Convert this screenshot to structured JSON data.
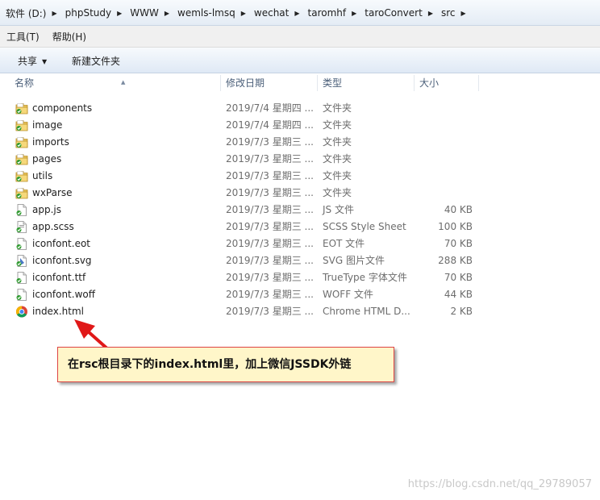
{
  "breadcrumb": [
    "软件 (D:)",
    "phpStudy",
    "WWW",
    "wemls-lmsq",
    "wechat",
    "taromhf",
    "taroConvert",
    "src"
  ],
  "menu": {
    "tools": "工具(T)",
    "help": "帮助(H)"
  },
  "toolbar": {
    "share": "共享",
    "new_folder": "新建文件夹"
  },
  "columns": {
    "name": "名称",
    "date": "修改日期",
    "type": "类型",
    "size": "大小"
  },
  "files": [
    {
      "name": "components",
      "date": "2019/7/4 星期四 ...",
      "type": "文件夹",
      "size": "",
      "icon": "folder-icon"
    },
    {
      "name": "image",
      "date": "2019/7/4 星期四 ...",
      "type": "文件夹",
      "size": "",
      "icon": "folder-icon"
    },
    {
      "name": "imports",
      "date": "2019/7/3 星期三 ...",
      "type": "文件夹",
      "size": "",
      "icon": "folder-icon"
    },
    {
      "name": "pages",
      "date": "2019/7/3 星期三 ...",
      "type": "文件夹",
      "size": "",
      "icon": "folder-icon"
    },
    {
      "name": "utils",
      "date": "2019/7/3 星期三 ...",
      "type": "文件夹",
      "size": "",
      "icon": "folder-icon"
    },
    {
      "name": "wxParse",
      "date": "2019/7/3 星期三 ...",
      "type": "文件夹",
      "size": "",
      "icon": "folder-icon"
    },
    {
      "name": "app.js",
      "date": "2019/7/3 星期三 ...",
      "type": "JS 文件",
      "size": "40 KB",
      "icon": "file-icon"
    },
    {
      "name": "app.scss",
      "date": "2019/7/3 星期三 ...",
      "type": "SCSS Style Sheet",
      "size": "100 KB",
      "icon": "file-icon"
    },
    {
      "name": "iconfont.eot",
      "date": "2019/7/3 星期三 ...",
      "type": "EOT 文件",
      "size": "70 KB",
      "icon": "file-icon"
    },
    {
      "name": "iconfont.svg",
      "date": "2019/7/3 星期三 ...",
      "type": "SVG 图片文件",
      "size": "288 KB",
      "icon": "svg-file-icon"
    },
    {
      "name": "iconfont.ttf",
      "date": "2019/7/3 星期三 ...",
      "type": "TrueType 字体文件",
      "size": "70 KB",
      "icon": "file-icon"
    },
    {
      "name": "iconfont.woff",
      "date": "2019/7/3 星期三 ...",
      "type": "WOFF 文件",
      "size": "44 KB",
      "icon": "file-icon"
    },
    {
      "name": "index.html",
      "date": "2019/7/3 星期三 ...",
      "type": "Chrome HTML D...",
      "size": "2 KB",
      "icon": "chrome-icon"
    }
  ],
  "annotation": "在rsc根目录下的index.html里，加上微信JSSDK外链",
  "watermark": "https://blog.csdn.net/qq_29789057",
  "colors": {
    "annotation_bg": "#fff6c9",
    "annotation_border": "#dd4444",
    "arrow": "#e01818"
  }
}
